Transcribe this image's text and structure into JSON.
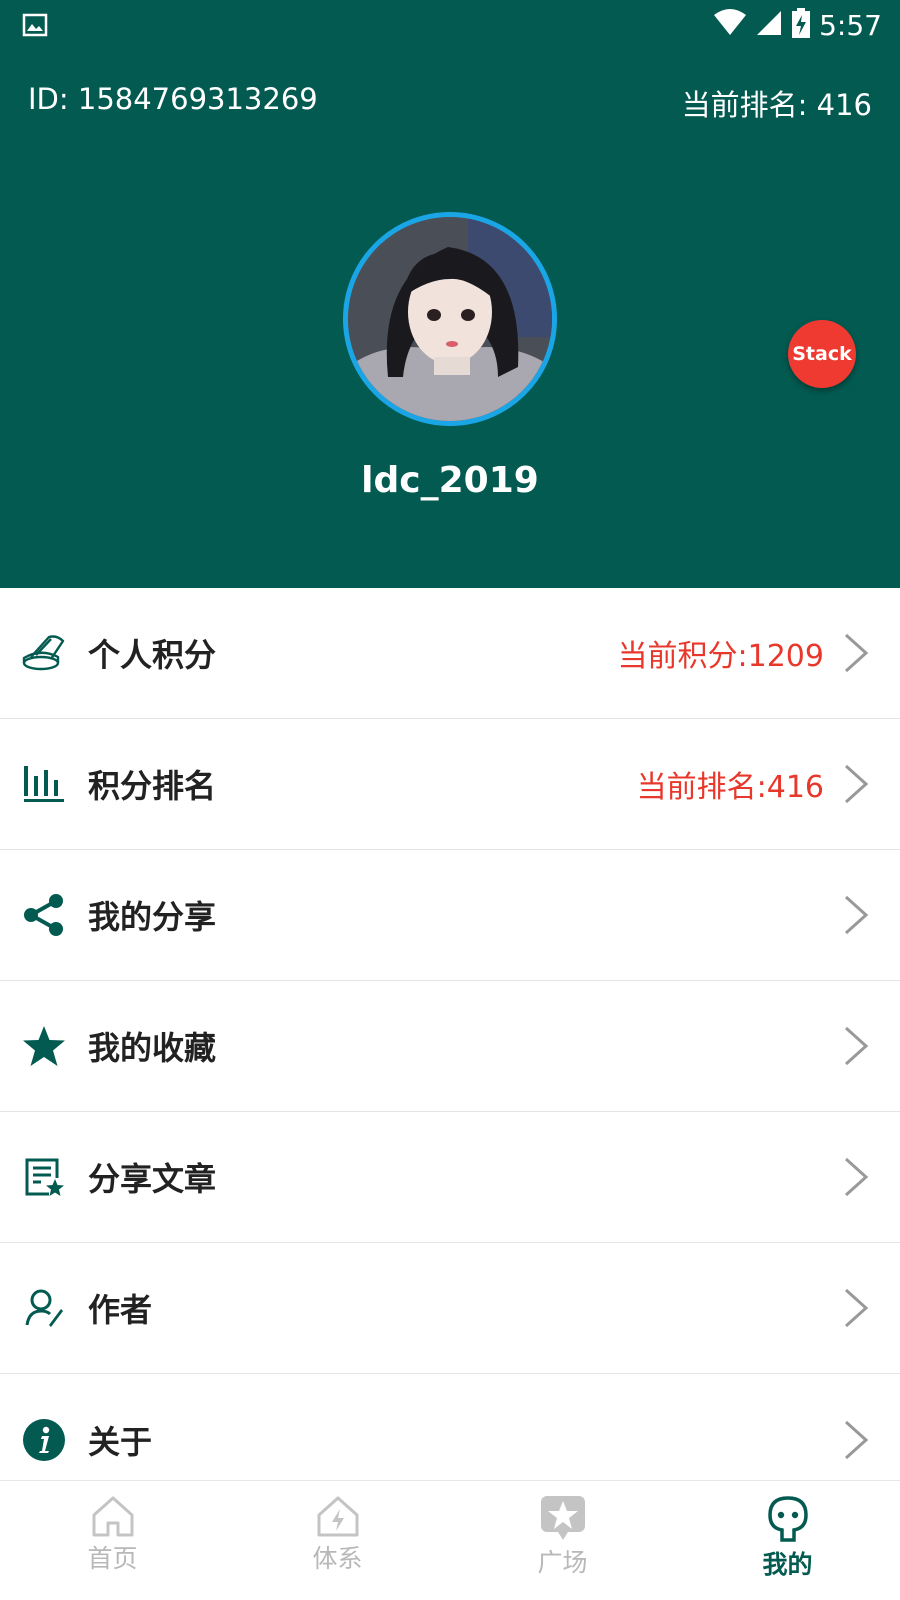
{
  "status_bar": {
    "time": "5:57"
  },
  "header": {
    "user_id": "ID: 1584769313269",
    "rank_text": "当前排名: 416",
    "username": "ldc_2019",
    "fab_label": "Stack"
  },
  "menu": {
    "items": [
      {
        "icon": "coins-icon",
        "label": "个人积分",
        "value": "当前积分:1209"
      },
      {
        "icon": "bar-chart-icon",
        "label": "积分排名",
        "value": "当前排名:416"
      },
      {
        "icon": "share-icon",
        "label": "我的分享",
        "value": ""
      },
      {
        "icon": "star-icon",
        "label": "我的收藏",
        "value": ""
      },
      {
        "icon": "article-icon",
        "label": "分享文章",
        "value": ""
      },
      {
        "icon": "author-icon",
        "label": "作者",
        "value": ""
      },
      {
        "icon": "info-icon",
        "label": "关于",
        "value": ""
      }
    ]
  },
  "bottom_nav": {
    "items": [
      {
        "icon": "home-icon",
        "label": "首页"
      },
      {
        "icon": "system-icon",
        "label": "体系"
      },
      {
        "icon": "square-icon",
        "label": "广场"
      },
      {
        "icon": "mine-icon",
        "label": "我的"
      }
    ],
    "active": "我的"
  },
  "colors": {
    "primary": "#035a50",
    "accent_red": "#e8382c",
    "fab_red": "#ef3a31",
    "avatar_border": "#1aa6e6",
    "nav_inactive": "#b8b8b8"
  }
}
